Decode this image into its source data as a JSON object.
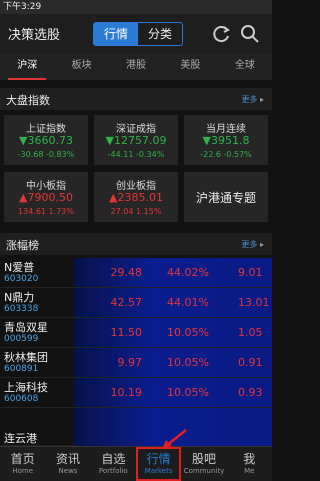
{
  "status": {
    "time": "下午3:29"
  },
  "header": {
    "title": "决策选股",
    "seg": [
      "行情",
      "分类"
    ]
  },
  "tabs": [
    "沪深",
    "板块",
    "港股",
    "美股",
    "全球"
  ],
  "index_section": {
    "title": "大盘指数",
    "more": "更多"
  },
  "cards": [
    {
      "name": "上证指数",
      "value": "▼3660.73",
      "change": "-30.68 -0.83%",
      "dir": "dn"
    },
    {
      "name": "深证成指",
      "value": "▼12757.09",
      "change": "-44.11 -0.34%",
      "dir": "dn"
    },
    {
      "name": "当月连续",
      "value": "▼3951.8",
      "change": "-22.6 -0.57%",
      "dir": "dn"
    },
    {
      "name": "中小板指",
      "value": "▲7900.50",
      "change": "134.61 1.73%",
      "dir": "up"
    },
    {
      "name": "创业板指",
      "value": "▲2385.01",
      "change": "27.04 1.15%",
      "dir": "up"
    },
    {
      "name": "沪港通专题",
      "special": true
    }
  ],
  "gainers_section": {
    "title": "涨幅榜",
    "more": "更多"
  },
  "rows": [
    {
      "name": "N爱普",
      "code": "603020",
      "price": "29.48",
      "pct": "44.02%",
      "extra": "9.01"
    },
    {
      "name": "N鼎力",
      "code": "603338",
      "price": "42.57",
      "pct": "44.01%",
      "extra": "13.01"
    },
    {
      "name": "青岛双星",
      "code": "000599",
      "price": "11.50",
      "pct": "10.05%",
      "extra": "1.05"
    },
    {
      "name": "秋林集团",
      "code": "600891",
      "price": "9.97",
      "pct": "10.05%",
      "extra": "0.91"
    },
    {
      "name": "上海科技",
      "code": "600608",
      "price": "10.19",
      "pct": "10.05%",
      "extra": "0.93"
    },
    {
      "name": "连云港",
      "code": "",
      "price": "",
      "pct": "",
      "extra": ""
    }
  ],
  "bottom_nav": [
    {
      "zh": "首页",
      "en": "Home"
    },
    {
      "zh": "资讯",
      "en": "News"
    },
    {
      "zh": "自选",
      "en": "Portfolio"
    },
    {
      "zh": "行情",
      "en": "Markets",
      "active": true
    },
    {
      "zh": "股吧",
      "en": "Community"
    },
    {
      "zh": "我",
      "en": "Me"
    }
  ],
  "colors": {
    "accent": "#2b7bd6",
    "up": "#e53535",
    "down": "#2fb34a"
  }
}
